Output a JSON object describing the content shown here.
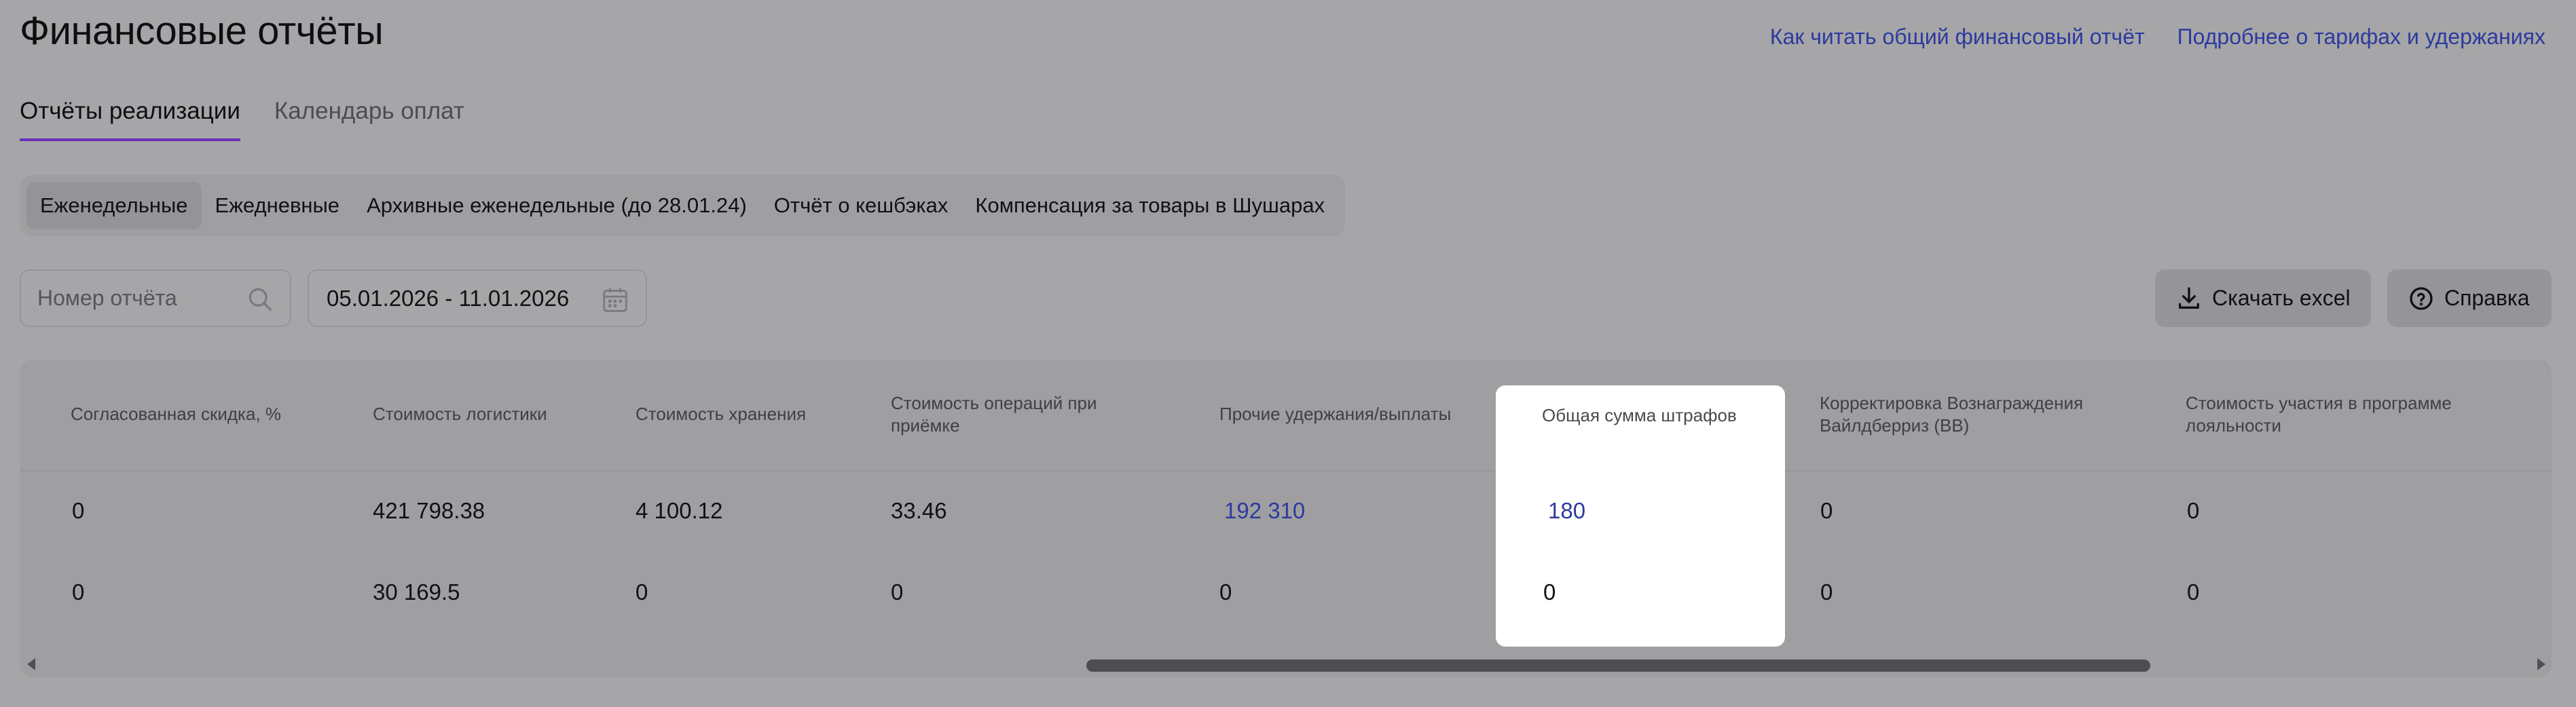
{
  "page_title": "Финансовые отчёты",
  "links": {
    "read_report": "Как читать общий финансовый отчёт",
    "tariffs": "Подробнее о тарифах и удержаниях"
  },
  "tabs": [
    {
      "label": "Отчёты реализации",
      "active": true
    },
    {
      "label": "Календарь оплат",
      "active": false
    }
  ],
  "segments": [
    {
      "label": "Еженедельные",
      "selected": true
    },
    {
      "label": "Ежедневные",
      "selected": false
    },
    {
      "label": "Архивные еженедельные (до 28.01.24)",
      "selected": false
    },
    {
      "label": "Отчёт о кешбэках",
      "selected": false
    },
    {
      "label": "Компенсация за товары в Шушарах",
      "selected": false
    }
  ],
  "search": {
    "placeholder": "Номер отчёта",
    "value": ""
  },
  "date_range": "05.01.2026 - 11.01.2026",
  "buttons": {
    "excel": "Скачать excel",
    "help": "Справка"
  },
  "table": {
    "columns": [
      "Согласованная скидка, %",
      "Стоимость логистики",
      "Стоимость хранения",
      "Стоимость операций при приёмке",
      "Прочие удержания/выплаты",
      "Общая сумма штрафов",
      "Корректировка Вознаграждения Вайлдберриз (ВВ)",
      "Стоимость участия в программе лояльности"
    ],
    "rows": [
      [
        "0",
        "421 798.38",
        "4 100.12",
        "33.46",
        "192 310",
        "180",
        "0",
        "0"
      ],
      [
        "0",
        "30 169.5",
        "0",
        "0",
        "0",
        "0",
        "0",
        "0"
      ]
    ]
  },
  "colors": {
    "accent": "#6b2fb8",
    "link": "#2c3a9e",
    "overlay": "#a6a6a8"
  }
}
